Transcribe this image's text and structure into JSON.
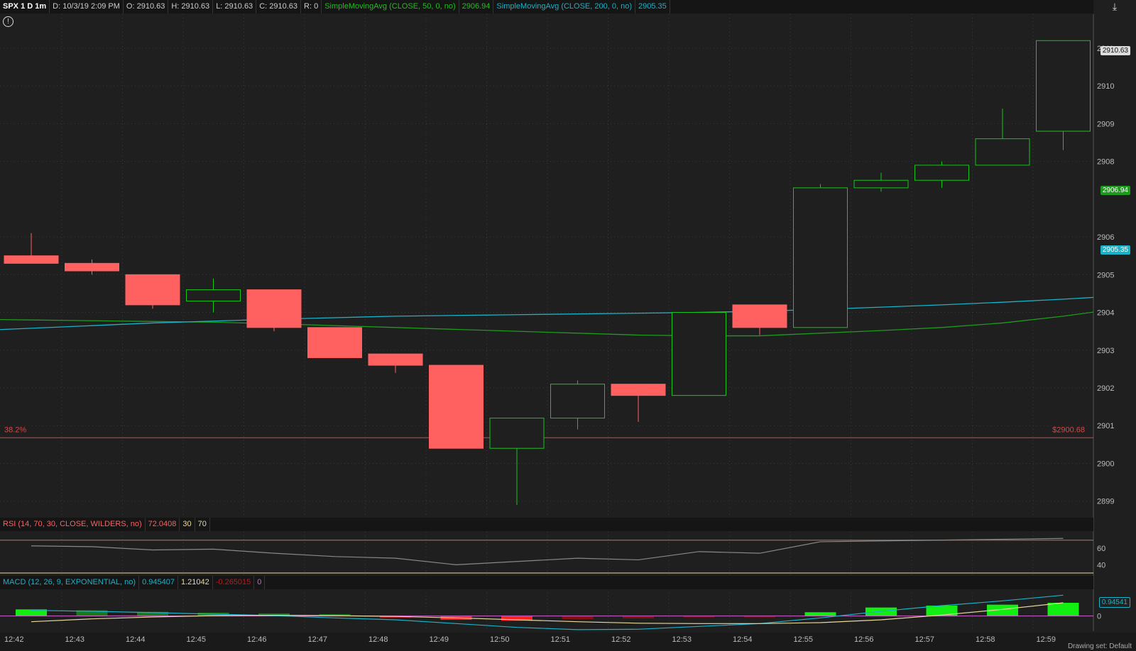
{
  "header": {
    "symbol": "SPX 1 D 1m",
    "date": "D: 10/3/19 2:09 PM",
    "open": "O: 2910.63",
    "high": "H: 2910.63",
    "low": "L: 2910.63",
    "close": "C: 2910.63",
    "range": "R: 0",
    "sma50_label": "SimpleMovingAvg (CLOSE, 50, 0, no)",
    "sma50_value": "2906.94",
    "sma200_label": "SimpleMovingAvg (CLOSE, 200, 0, no)",
    "sma200_value": "2905.35"
  },
  "price_boxes": {
    "last": "2910.63",
    "sma50": "2906.94",
    "sma200": "2905.35"
  },
  "fib": {
    "label": "38.2%",
    "price_label": "$2900.68",
    "value": 2900.68
  },
  "rsi_header": {
    "label": "RSI (14, 70, 30, CLOSE, WILDERS, no)",
    "value": "72.0408",
    "low": "30",
    "high": "70"
  },
  "macd_header": {
    "label": "MACD (12, 26, 9, EXPONENTIAL, no)",
    "value": "0.945407",
    "avg": "1.21042",
    "diff": "-0.265015",
    "zero": "0"
  },
  "macd_box": "0.94541",
  "status": "Drawing set: Default",
  "colors": {
    "up": "#19c419",
    "down": "#ff6060",
    "sma50": "#1f9a1f",
    "sma200": "#1ab2c8",
    "fib": "#d94848",
    "bg": "#1f1f1f",
    "grid": "#3a3a3a",
    "rsi": "#888888",
    "macd_pos": "#12ee12",
    "macd_pos_dim": "#1a7a1a",
    "macd_neg": "#ff2020",
    "macd_neg_dim": "#8a1010"
  },
  "chart_data": {
    "type": "candlestick",
    "x": [
      "12:42",
      "12:43",
      "12:44",
      "12:45",
      "12:46",
      "12:47",
      "12:48",
      "12:49",
      "12:50",
      "12:51",
      "12:52",
      "12:53",
      "12:54",
      "12:55",
      "12:56",
      "12:57",
      "12:58",
      "12:59"
    ],
    "ohlc": [
      [
        2905.5,
        2906.1,
        2905.3,
        2905.3
      ],
      [
        2905.3,
        2905.4,
        2905.0,
        2905.1
      ],
      [
        2905.0,
        2905.0,
        2904.1,
        2904.2
      ],
      [
        2904.3,
        2904.9,
        2904.0,
        2904.6
      ],
      [
        2904.6,
        2904.6,
        2903.5,
        2903.6
      ],
      [
        2903.6,
        2903.6,
        2902.8,
        2902.8
      ],
      [
        2902.9,
        2902.9,
        2902.4,
        2902.6
      ],
      [
        2902.6,
        2902.6,
        2900.4,
        2900.4
      ],
      [
        2900.4,
        2901.2,
        2898.9,
        2901.2
      ],
      [
        2901.2,
        2902.2,
        2900.9,
        2902.1
      ],
      [
        2902.1,
        2902.1,
        2901.1,
        2901.8
      ],
      [
        2901.8,
        2904.0,
        2901.8,
        2904.0
      ],
      [
        2904.2,
        2904.2,
        2903.4,
        2903.6
      ],
      [
        2903.6,
        2907.4,
        2903.6,
        2907.3
      ],
      [
        2907.3,
        2907.7,
        2907.2,
        2907.5
      ],
      [
        2907.5,
        2908.0,
        2907.3,
        2907.9
      ],
      [
        2907.9,
        2909.4,
        2907.9,
        2908.6
      ],
      [
        2908.8,
        2911.2,
        2908.3,
        2911.2
      ]
    ],
    "sma50": [
      2903.8,
      2903.78,
      2903.76,
      2903.74,
      2903.7,
      2903.65,
      2903.6,
      2903.55,
      2903.5,
      2903.45,
      2903.4,
      2903.38,
      2903.38,
      2903.45,
      2903.52,
      2903.6,
      2903.72,
      2903.9
    ],
    "sma200": [
      2903.58,
      2903.65,
      2903.72,
      2903.77,
      2903.82,
      2903.86,
      2903.9,
      2903.92,
      2903.94,
      2903.96,
      2903.98,
      2904.0,
      2904.03,
      2904.08,
      2904.14,
      2904.2,
      2904.27,
      2904.35
    ],
    "ylim": [
      2898.6,
      2911.9
    ],
    "yticks": [
      2899,
      2900,
      2901,
      2902,
      2903,
      2904,
      2905,
      2906,
      2908,
      2909,
      2910,
      2911
    ],
    "rsi": {
      "values": [
        63,
        62,
        58,
        59,
        54,
        50,
        48,
        40,
        44,
        48,
        46,
        56,
        54,
        68,
        69,
        70,
        71,
        72
      ],
      "ylim": [
        30,
        80
      ],
      "ticks": [
        40,
        60
      ],
      "levels": [
        30,
        70
      ]
    },
    "macd": {
      "value": [
        0.3,
        0.25,
        0.18,
        0.1,
        0.02,
        -0.1,
        -0.2,
        -0.4,
        -0.6,
        -0.72,
        -0.7,
        -0.55,
        -0.4,
        -0.1,
        0.25,
        0.55,
        0.8,
        1.1
      ],
      "avg": [
        -0.3,
        -0.15,
        -0.05,
        0.02,
        0.04,
        0.02,
        -0.02,
        -0.1,
        -0.2,
        -0.3,
        -0.38,
        -0.4,
        -0.4,
        -0.35,
        -0.2,
        0.05,
        0.35,
        0.7
      ],
      "diff": [
        0.35,
        0.3,
        0.22,
        0.18,
        0.14,
        0.1,
        -0.03,
        -0.2,
        -0.25,
        -0.16,
        -0.12,
        -0.08,
        -0.02,
        0.2,
        0.45,
        0.55,
        0.6,
        0.7
      ],
      "ylim": [
        -0.8,
        1.3
      ],
      "ticks": [
        0
      ]
    }
  }
}
